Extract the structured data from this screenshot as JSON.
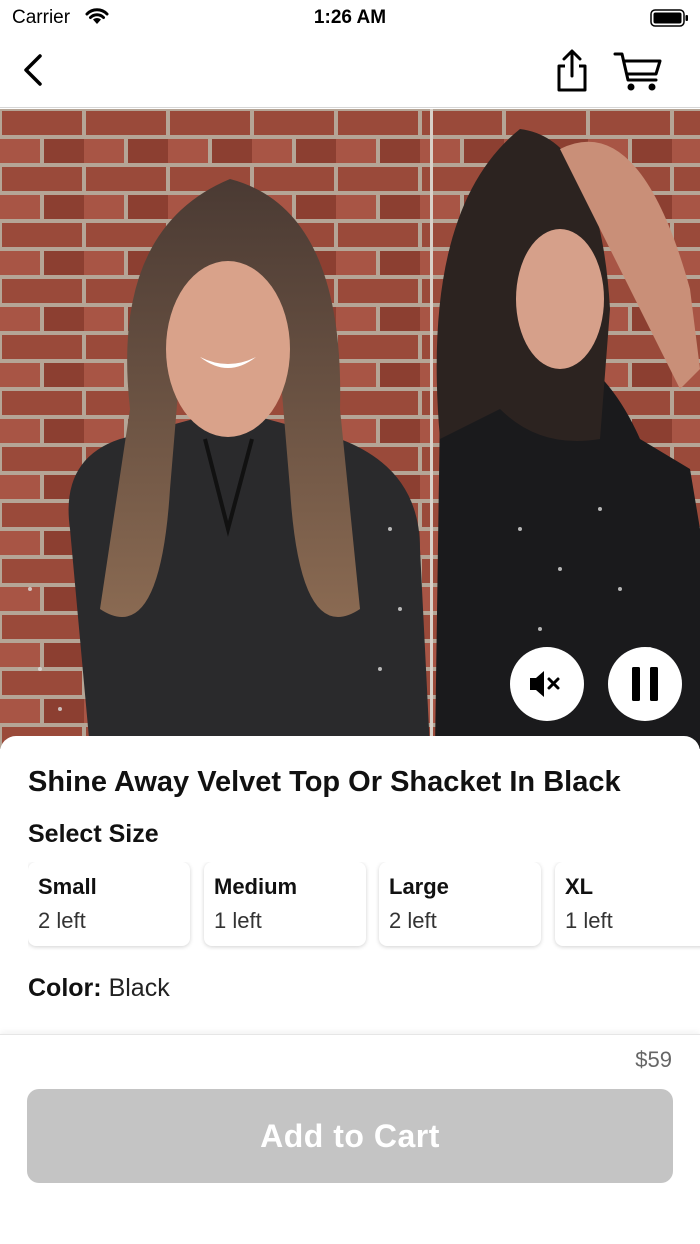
{
  "status_bar": {
    "carrier": "Carrier",
    "time": "1:26 AM"
  },
  "nav": {
    "back_icon": "chevron-left-icon",
    "share_icon": "share-icon",
    "cart_icon": "cart-icon"
  },
  "media": {
    "mute_icon": "speaker-muted-icon",
    "pause_icon": "pause-icon"
  },
  "product": {
    "title": "Shine Away Velvet Top Or Shacket In Black",
    "size_heading": "Select Size",
    "sizes": [
      {
        "name": "Small",
        "stock": "2 left"
      },
      {
        "name": "Medium",
        "stock": "1 left"
      },
      {
        "name": "Large",
        "stock": "2 left"
      },
      {
        "name": "XL",
        "stock": "1 left"
      }
    ],
    "color_label": "Color:",
    "color_value": "Black"
  },
  "footer": {
    "price": "$59",
    "add_to_cart_label": "Add to Cart"
  },
  "colors": {
    "button_disabled": "#c4c4c4",
    "brick": "#8c4a3a",
    "dress": "#1c1c1e"
  }
}
